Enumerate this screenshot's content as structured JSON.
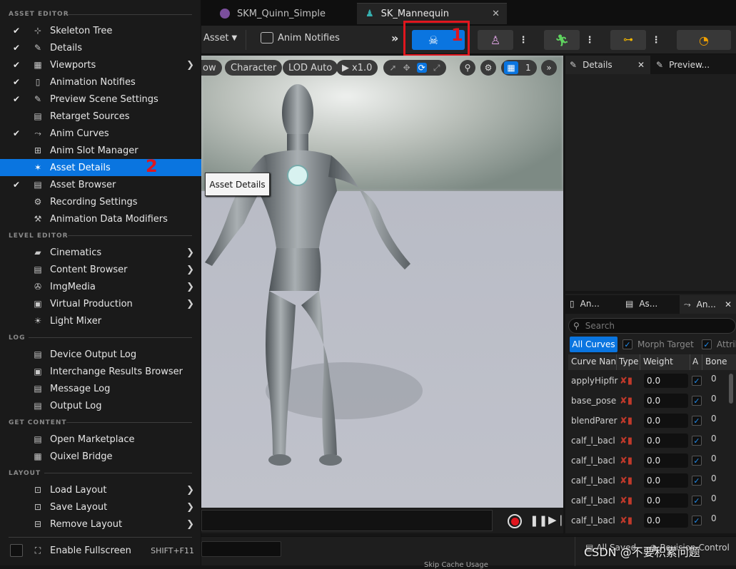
{
  "tabs": [
    {
      "label": "SKM_Quinn_Simple"
    },
    {
      "label": "SK_Mannequin"
    }
  ],
  "toolbar": {
    "asset_label": "Asset",
    "anim_notifies_label": "Anim Notifies"
  },
  "viewport": {
    "chips": [
      "ow",
      "Character",
      "LOD Auto",
      "x1.0"
    ],
    "grid_count": "1"
  },
  "details_panel": {
    "tabs": [
      {
        "label": "Details"
      },
      {
        "label": "Preview..."
      }
    ]
  },
  "curves_panel": {
    "tabs": [
      "An...",
      "As...",
      "An..."
    ],
    "search_placeholder": "Search",
    "filters": [
      "All Curves",
      "Morph Target",
      "Attrib"
    ],
    "columns": [
      "Curve Nan",
      "Type",
      "Weight",
      "A",
      "Bone"
    ],
    "rows": [
      {
        "name": "applyHipfir",
        "weight": "0.0",
        "bone": "0"
      },
      {
        "name": "base_pose",
        "weight": "0.0",
        "bone": "0"
      },
      {
        "name": "blendParer",
        "weight": "0.0",
        "bone": "0"
      },
      {
        "name": "calf_l_bacl",
        "weight": "0.0",
        "bone": "0"
      },
      {
        "name": "calf_l_bacl",
        "weight": "0.0",
        "bone": "0"
      },
      {
        "name": "calf_l_bacl",
        "weight": "0.0",
        "bone": "0"
      },
      {
        "name": "calf_l_bacl",
        "weight": "0.0",
        "bone": "0"
      },
      {
        "name": "calf_l_bacl",
        "weight": "0.0",
        "bone": "0"
      }
    ]
  },
  "statusbar": {
    "all_saved": "All Saved",
    "revision": "Revision Control",
    "skip_cache": "Skip Cache Usage"
  },
  "watermark": "CSDN @不要积累问题",
  "annotations": {
    "one": "1",
    "two": "2"
  },
  "tooltip": "Asset Details",
  "menu": {
    "sections": [
      {
        "title": "ASSET EDITOR"
      },
      {
        "title": "LEVEL EDITOR"
      },
      {
        "title": "LOG"
      },
      {
        "title": "GET CONTENT"
      },
      {
        "title": "LAYOUT"
      }
    ],
    "items": [
      {
        "label": "Skeleton Tree",
        "checked": true
      },
      {
        "label": "Details",
        "checked": true
      },
      {
        "label": "Viewports",
        "checked": true,
        "submenu": true
      },
      {
        "label": "Animation Notifies",
        "checked": true
      },
      {
        "label": "Preview Scene Settings",
        "checked": true
      },
      {
        "label": "Retarget Sources",
        "checked": false
      },
      {
        "label": "Anim Curves",
        "checked": true
      },
      {
        "label": "Anim Slot Manager",
        "checked": false
      },
      {
        "label": "Asset Details",
        "checked": false,
        "highlighted": true
      },
      {
        "label": "Asset Browser",
        "checked": true
      },
      {
        "label": "Recording Settings",
        "checked": false
      },
      {
        "label": "Animation Data Modifiers",
        "checked": false
      },
      {
        "label": "Cinematics",
        "submenu": true
      },
      {
        "label": "Content Browser",
        "submenu": true
      },
      {
        "label": "ImgMedia",
        "submenu": true
      },
      {
        "label": "Virtual Production",
        "submenu": true
      },
      {
        "label": "Light Mixer"
      },
      {
        "label": "Device Output Log"
      },
      {
        "label": "Interchange Results Browser"
      },
      {
        "label": "Message Log"
      },
      {
        "label": "Output Log"
      },
      {
        "label": "Open Marketplace"
      },
      {
        "label": "Quixel Bridge"
      },
      {
        "label": "Load Layout",
        "submenu": true
      },
      {
        "label": "Save Layout",
        "submenu": true
      },
      {
        "label": "Remove Layout",
        "submenu": true
      },
      {
        "label": "Enable Fullscreen",
        "shortcut": "SHIFT+F11"
      }
    ]
  },
  "colors": {
    "accent": "#0a75e0",
    "annotation": "#e0161e"
  }
}
